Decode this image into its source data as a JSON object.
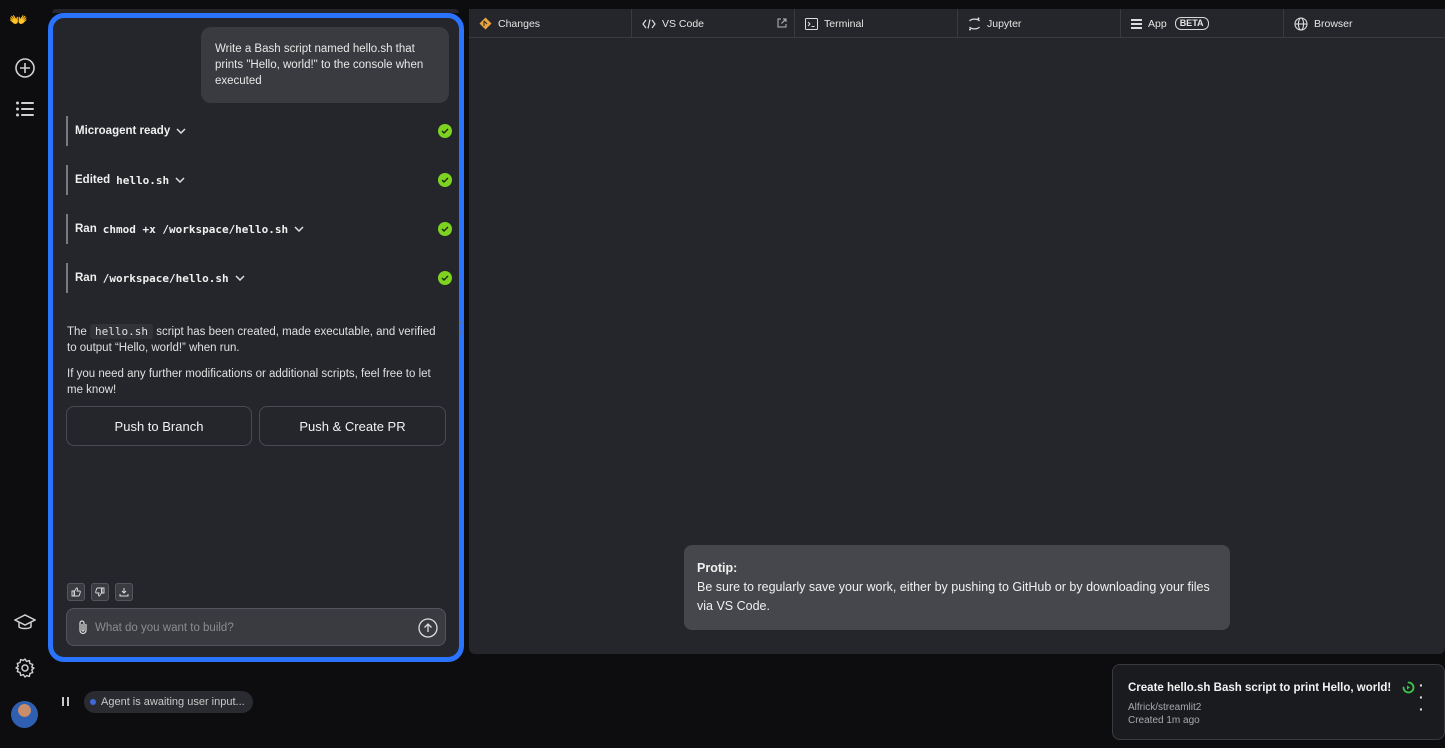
{
  "rail": {
    "logo": "👐",
    "icons": [
      "plus-circle-icon",
      "list-icon",
      "graduation-cap-icon",
      "gear-icon"
    ]
  },
  "chat": {
    "user_message": "Write a Bash script named hello.sh that prints \"Hello, world!\" to the console when executed",
    "steps": [
      {
        "prefix": "Microagent ready",
        "code": ""
      },
      {
        "prefix": "Edited",
        "code": "hello.sh"
      },
      {
        "prefix": "Ran",
        "code": "chmod +x /workspace/hello.sh"
      },
      {
        "prefix": "Ran",
        "code": "/workspace/hello.sh"
      }
    ],
    "summary": {
      "before": "The",
      "code": "hello.sh",
      "after": "script has been created, made executable, and verified to output “Hello, world!” when run."
    },
    "followup": "If you need any further modifications or additional scripts, feel free to let me know!",
    "push_branch_label": "Push to Branch",
    "push_pr_label": "Push & Create PR",
    "composer_placeholder": "What do you want to build?"
  },
  "tabs": [
    {
      "label": "Changes",
      "icon": "git-diamond-icon"
    },
    {
      "label": "VS Code",
      "icon": "code-icon"
    },
    {
      "label": "Terminal",
      "icon": "terminal-icon"
    },
    {
      "label": "Jupyter",
      "icon": "jupyter-icon"
    },
    {
      "label": "App",
      "icon": "app-icon",
      "badge": "BETA"
    },
    {
      "label": "Browser",
      "icon": "globe-icon"
    }
  ],
  "protip": {
    "title": "Protip:",
    "body": "Be sure to regularly save your work, either by pushing to GitHub or by downloading your files via VS Code."
  },
  "footer": {
    "status": "Agent is awaiting user input..."
  },
  "task_card": {
    "title": "Create hello.sh Bash script to print Hello, world!",
    "repo": "Alfrick/streamlit2",
    "created": "Created 1m ago"
  },
  "colors": {
    "accent_border": "#2a73ff",
    "success": "#7ed321",
    "panel": "#25262b",
    "background": "#0d0d0f"
  }
}
